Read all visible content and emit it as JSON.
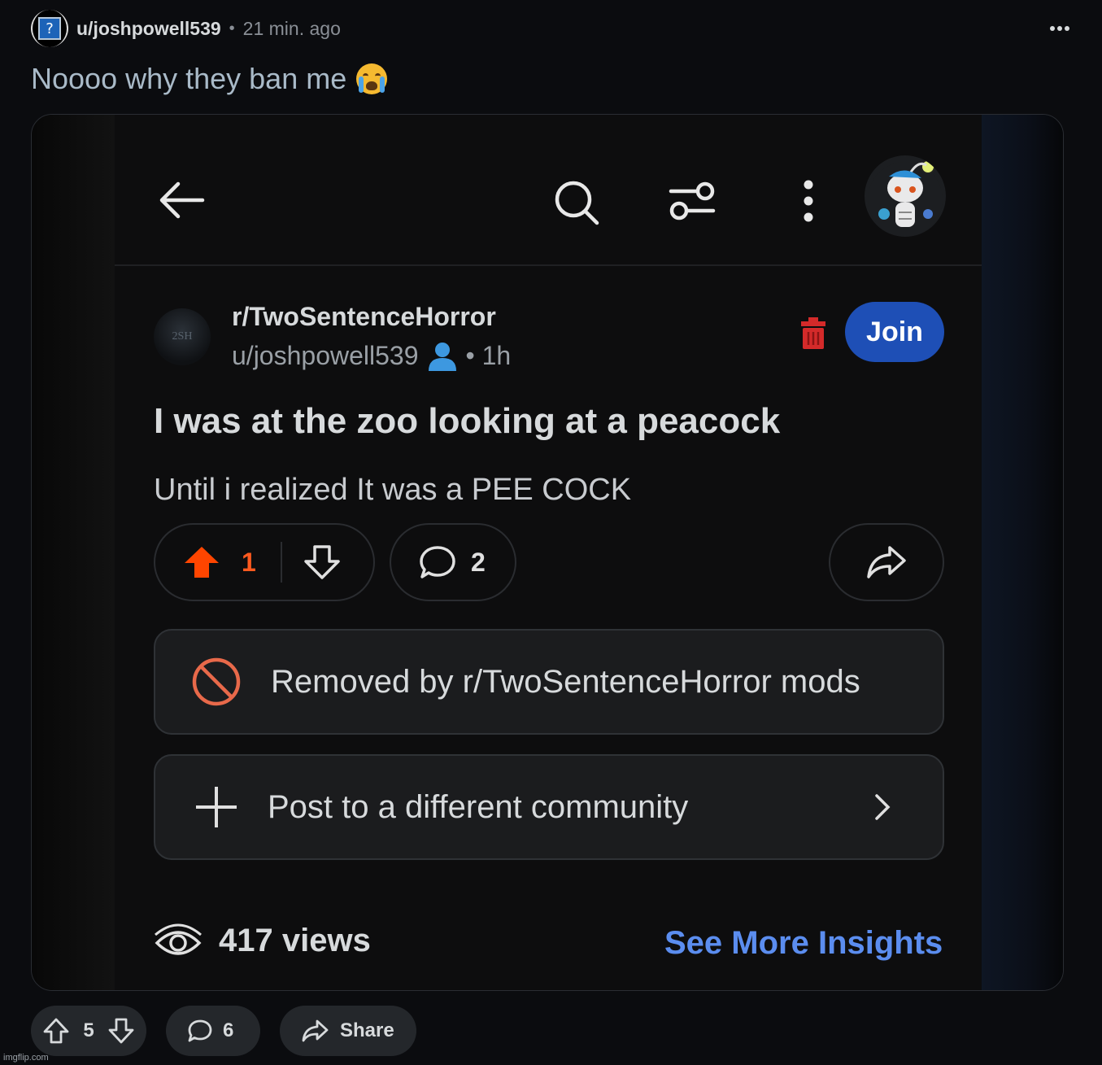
{
  "post": {
    "username": "u/joshpowell539",
    "separator": "•",
    "time": "21 min. ago",
    "title": "Noooo why they ban me"
  },
  "screenshot": {
    "subreddit": "r/TwoSentenceHorror",
    "subreddit_avatar_text": "2SH",
    "author": "u/joshpowell539",
    "age": "• 1h",
    "join_label": "Join",
    "title": "I was at the zoo looking at a peacock",
    "body": "Until i realized It was a PEE COCK",
    "upvotes": "1",
    "comments": "2",
    "removed_text": "Removed by r/TwoSentenceHorror mods",
    "post_different_text": "Post to a different community",
    "views": "417 views",
    "insights_label": "See More Insights",
    "upvote_color": "#ff4500",
    "removed_icon_color": "#e8694a",
    "join_color": "#1e4fb6"
  },
  "actions": {
    "score": "5",
    "comments": "6",
    "share_label": "Share"
  },
  "watermark": "imgflip.com"
}
